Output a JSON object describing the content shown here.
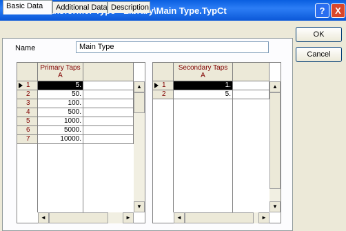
{
  "window": {
    "title": "Current Transformer Type - Library\\Main Type.TypCt"
  },
  "titlebar": {
    "help_label": "?",
    "close_label": "X"
  },
  "tabs": [
    {
      "label": "Basic Data",
      "active": true
    },
    {
      "label": "Additional Data",
      "active": false
    },
    {
      "label": "Description",
      "active": false
    }
  ],
  "form": {
    "name_label": "Name",
    "name_value": "Main Type"
  },
  "primary_grid": {
    "header": "Primary Taps",
    "unit": "A",
    "rows": [
      {
        "num": "1",
        "value": "5."
      },
      {
        "num": "2",
        "value": "50."
      },
      {
        "num": "3",
        "value": "100."
      },
      {
        "num": "4",
        "value": "500."
      },
      {
        "num": "5",
        "value": "1000."
      },
      {
        "num": "6",
        "value": "5000."
      },
      {
        "num": "7",
        "value": "10000."
      }
    ]
  },
  "secondary_grid": {
    "header": "Secondary Taps",
    "unit": "A",
    "rows": [
      {
        "num": "1",
        "value": "1."
      },
      {
        "num": "2",
        "value": "5."
      }
    ]
  },
  "buttons": {
    "ok": "OK",
    "cancel": "Cancel"
  },
  "scroll_glyphs": {
    "up": "▲",
    "down": "▼",
    "left": "◄",
    "right": "►"
  }
}
